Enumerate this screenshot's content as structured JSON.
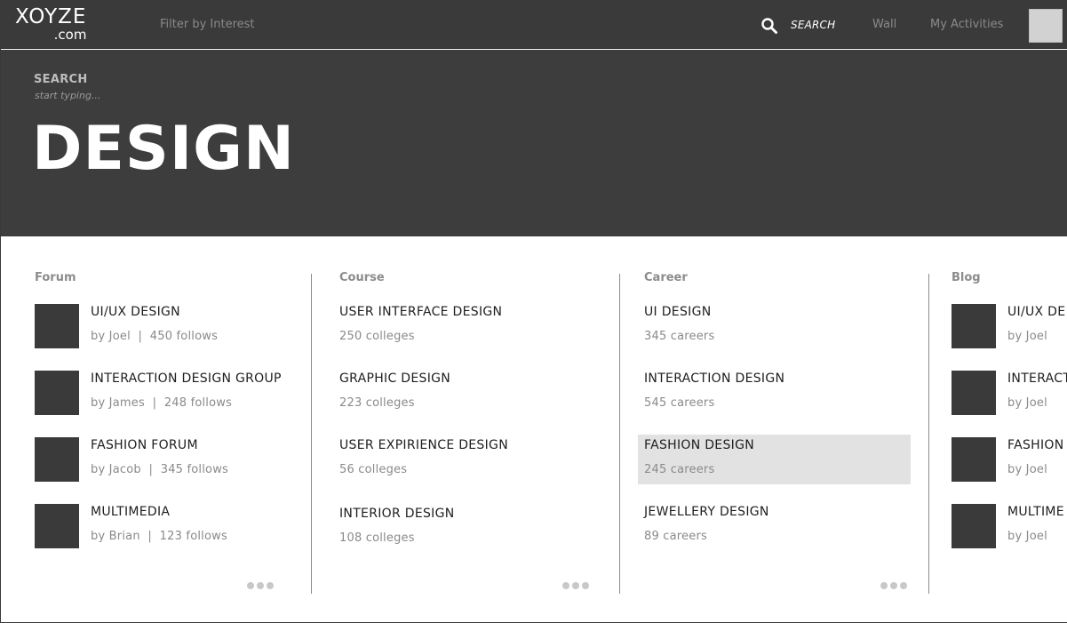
{
  "header": {
    "logo_main": "XOYZE",
    "logo_sub": ".com",
    "filter_placeholder": "Filter by Interest",
    "search_label": "SEARCH",
    "nav": [
      "Wall",
      "My Activities"
    ]
  },
  "hero": {
    "search_label": "SEARCH",
    "search_hint": "start typing...",
    "title": "DESIGN"
  },
  "forum": {
    "title": "Forum",
    "items": [
      {
        "title": "UI/UX DESIGN",
        "meta": "by Joel  |  450 follows"
      },
      {
        "title": "INTERACTION DESIGN GROUP",
        "meta": "by James  |  248 follows"
      },
      {
        "title": "FASHION FORUM",
        "meta": "by Jacob  |  345 follows"
      },
      {
        "title": "MULTIMEDIA",
        "meta": "by Brian  |  123 follows"
      }
    ]
  },
  "course": {
    "title": "Course",
    "items": [
      {
        "title": "USER INTERFACE DESIGN",
        "meta": "250 colleges"
      },
      {
        "title": "GRAPHIC DESIGN",
        "meta": "223 colleges"
      },
      {
        "title": "USER EXPIRIENCE DESIGN",
        "meta": "56 colleges"
      },
      {
        "title": "INTERIOR DESIGN",
        "meta": "108 colleges"
      }
    ]
  },
  "career": {
    "title": "Career",
    "items": [
      {
        "title": "UI DESIGN",
        "meta": "345 careers"
      },
      {
        "title": "INTERACTION DESIGN",
        "meta": "545 careers"
      },
      {
        "title": "FASHION DESIGN",
        "meta": "245 careers",
        "highlighted": true
      },
      {
        "title": "JEWELLERY DESIGN",
        "meta": "89 careers"
      }
    ]
  },
  "blog": {
    "title": "Blog",
    "items": [
      {
        "title": "UI/UX DE",
        "meta": "by Joel"
      },
      {
        "title": "INTERACT",
        "meta": "by Joel"
      },
      {
        "title": "FASHION",
        "meta": "by Joel"
      },
      {
        "title": "MULTIME",
        "meta": "by Joel"
      }
    ]
  },
  "colors": {
    "header_bg": "#3a3a3a",
    "hero_bg": "#3d3d3d",
    "highlight_bg": "#e2e2e3"
  }
}
